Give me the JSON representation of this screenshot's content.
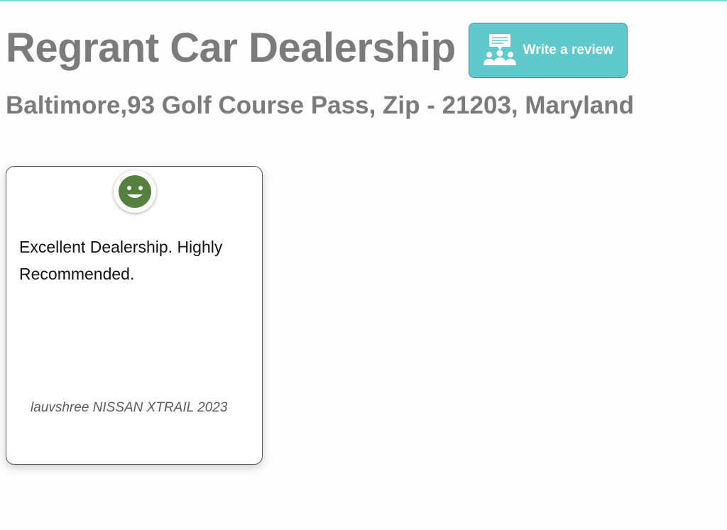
{
  "dealer": {
    "name": "Regrant Car Dealership",
    "address": "Baltimore,93 Golf Course Pass, Zip - 21203, Maryland"
  },
  "write_review": {
    "label": "Write a review",
    "icon": "people-discussion-icon"
  },
  "reviews": [
    {
      "sentiment": "positive",
      "sentiment_icon": "smiley-face-icon",
      "text": "Excellent Dealership. Highly Recommended.",
      "reviewer_car": "lauvshree NISSAN XTRAIL 2023"
    }
  ],
  "colors": {
    "accent": "#5fc9cc",
    "heading": "#7b7b7b",
    "smiley": "#55803f"
  }
}
